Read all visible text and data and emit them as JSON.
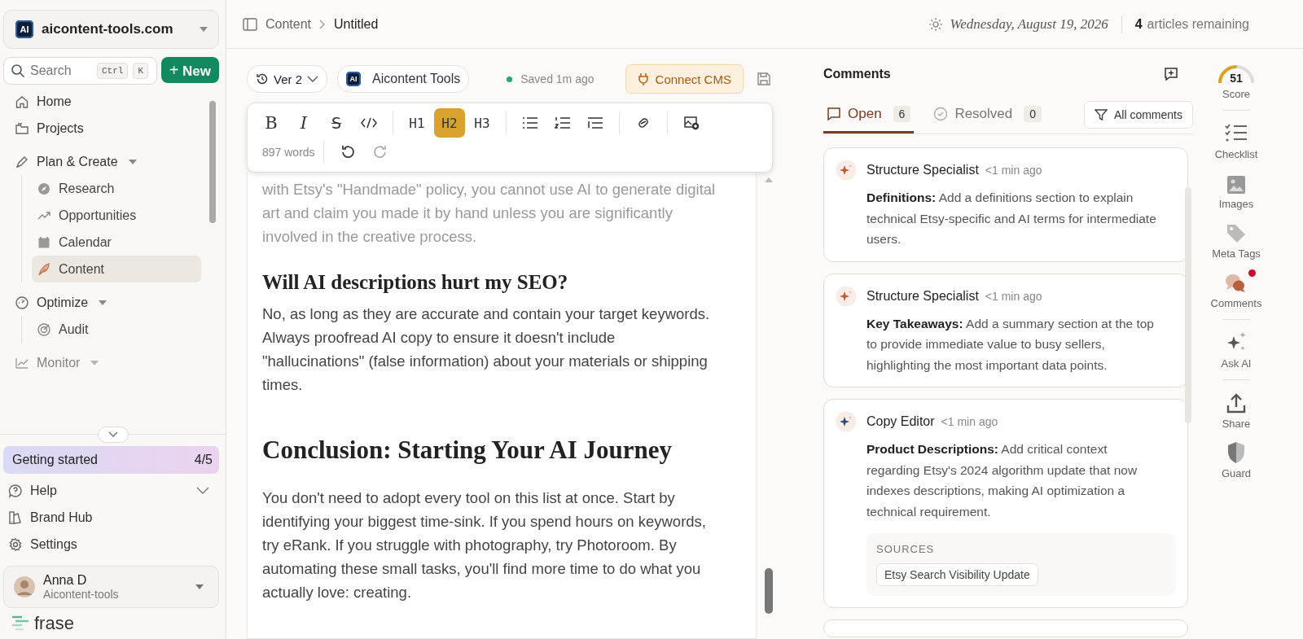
{
  "workspace": {
    "name": "aicontent-tools.com",
    "logo": "AI"
  },
  "search": {
    "placeholder": "Search",
    "shortcut": [
      "Ctrl",
      "K"
    ]
  },
  "new_button": {
    "label": "New",
    "icon": "+"
  },
  "nav": [
    {
      "label": "Home",
      "kind": "home",
      "selected": false
    },
    {
      "label": "Projects",
      "kind": "folder",
      "selected": false
    },
    {
      "label": "Plan & Create",
      "kind": "plan",
      "selected": false,
      "expanded": true,
      "children": [
        {
          "label": "Research",
          "kind": "compass",
          "selected": false
        },
        {
          "label": "Opportunities",
          "kind": "trend",
          "selected": false
        },
        {
          "label": "Calendar",
          "kind": "calendar",
          "selected": false
        },
        {
          "label": "Content",
          "kind": "feather",
          "selected": true
        }
      ]
    },
    {
      "label": "Optimize",
      "kind": "optimize",
      "selected": false,
      "expanded": true,
      "children": [
        {
          "label": "Audit",
          "kind": "target",
          "selected": false
        }
      ]
    },
    {
      "label": "Monitor",
      "kind": "monitor",
      "selected": false,
      "faded": true
    }
  ],
  "getting_started": {
    "label": "Getting started",
    "progress": "4/5"
  },
  "bottom_nav": [
    {
      "label": "Help",
      "kind": "help",
      "selected": false,
      "dropdown": true
    },
    {
      "label": "Brand Hub",
      "kind": "brand",
      "selected": false,
      "dropdown": false
    },
    {
      "label": "Settings",
      "kind": "gear",
      "selected": false,
      "dropdown": false
    }
  ],
  "user": {
    "name": "Anna D",
    "org": "Aicontent-tools"
  },
  "brand": "frase",
  "breadcrumb": [
    "Content",
    "Untitled"
  ],
  "date": "Wednesday, August 19, 2026",
  "articles": {
    "count": "4",
    "label": "articles remaining"
  },
  "editor_bar": {
    "version": "Ver 2",
    "project": "Aicontent Tools",
    "project_logo": "AI",
    "status": "Saved 1m ago",
    "connect": "Connect CMS"
  },
  "toolbar": {
    "groups": [
      [
        {
          "kind": "bold",
          "label": "B"
        },
        {
          "kind": "italic",
          "label": "I"
        },
        {
          "kind": "strike",
          "label": "S"
        },
        {
          "kind": "code"
        }
      ],
      [
        {
          "kind": "heading",
          "label": "H1",
          "selected": false
        },
        {
          "kind": "heading",
          "label": "H2",
          "selected": true
        },
        {
          "kind": "heading",
          "label": "H3",
          "selected": false
        }
      ],
      [
        {
          "kind": "bullets"
        },
        {
          "kind": "numbers"
        },
        {
          "kind": "indent"
        }
      ],
      [
        {
          "kind": "link"
        }
      ],
      [
        {
          "kind": "image"
        }
      ]
    ],
    "word_count": "897 words"
  },
  "document": [
    {
      "kind": "paragraph",
      "text": "with Etsy's \"Handmade\" policy, you cannot use AI to generate digital art and claim you made it by hand unless you are significantly involved in the creative process.",
      "faded": true
    },
    {
      "kind": "h3",
      "text": "Will AI descriptions hurt my SEO?"
    },
    {
      "kind": "paragraph",
      "text": "No, as long as they are accurate and contain your target keywords. Always proofread AI copy to ensure it doesn't include \"hallucinations\" (false information) about your materials or shipping times.",
      "faded": false
    },
    {
      "kind": "h2",
      "text": "Conclusion: Starting Your AI Journey"
    },
    {
      "kind": "paragraph",
      "text": "You don't need to adopt every tool on this list at once. Start by identifying your biggest time-sink. If you spend hours on keywords, try eRank. If you struggle with photography, try Photoroom. By automating these small tasks, you'll find more time to do what you actually love: creating.",
      "faded": false
    }
  ],
  "comments_panel": {
    "title": "Comments",
    "tabs": [
      {
        "label": "Open",
        "count": "6",
        "selected": true
      },
      {
        "label": "Resolved",
        "count": "0",
        "selected": false
      }
    ],
    "filter": "All comments",
    "comments": [
      {
        "author": "Structure Specialist",
        "time": "<1 min ago",
        "color": "#c2562e",
        "text": "**Definitions:** Add a definitions section to explain technical Etsy-specific and AI terms for intermediate users."
      },
      {
        "author": "Structure Specialist",
        "time": "<1 min ago",
        "color": "#c2562e",
        "text": "**Key Takeaways:** Add a summary section at the top to provide immediate value to busy sellers, highlighting the most important data points."
      },
      {
        "author": "Copy Editor",
        "time": "<1 min ago",
        "color": "#2f4a7a",
        "text": "**Product Descriptions:** Add critical context regarding Etsy's 2024 algorithm update that now indexes descriptions, making AI optimization a technical requirement.",
        "sources_label": "SOURCES",
        "sources": [
          "Etsy Search Visibility Update"
        ]
      }
    ]
  },
  "rail": {
    "score": {
      "value": "51",
      "label": "Score",
      "level": 0.51
    },
    "items": [
      {
        "kind": "checklist",
        "label": "Checklist",
        "notification": false
      },
      {
        "kind": "images",
        "label": "Images",
        "notification": false
      },
      {
        "kind": "tags",
        "label": "Meta Tags",
        "notification": false
      },
      {
        "kind": "comments",
        "label": "Comments",
        "notification": true
      },
      {
        "kind": "ai",
        "label": "Ask AI",
        "notification": false
      },
      {
        "kind": "share",
        "label": "Share",
        "notification": false
      },
      {
        "kind": "guard",
        "label": "Guard",
        "notification": false
      }
    ]
  }
}
